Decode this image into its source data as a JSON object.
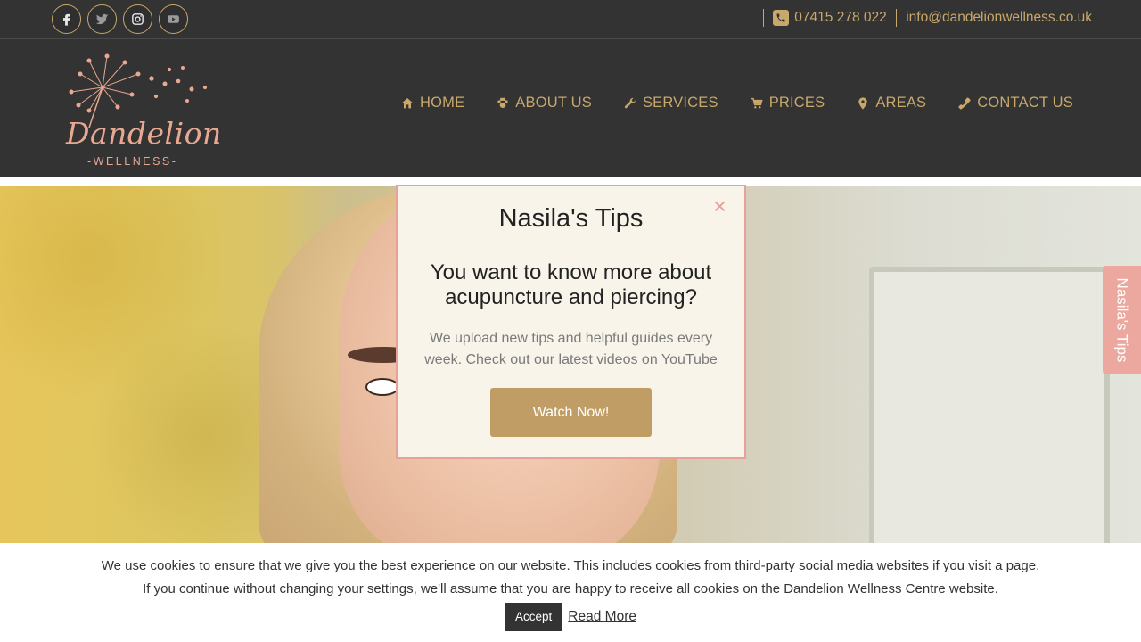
{
  "colors": {
    "header_bg": "#333333",
    "accent_gold": "#c8a86b",
    "logo_pink": "#e8a891",
    "modal_bg": "#f9f4ea",
    "modal_border": "#e8a19a",
    "button_gold": "#c09d65",
    "sidetab_bg": "#eca79e"
  },
  "topbar": {
    "social_icons": [
      "facebook-icon",
      "twitter-icon",
      "instagram-icon",
      "youtube-icon"
    ],
    "phone": "07415 278 022",
    "email": "info@dandelionwellness.co.uk"
  },
  "logo": {
    "brand": "Dandelion",
    "subtitle": "-WELLNESS-"
  },
  "nav": {
    "items": [
      {
        "label": "HOME",
        "icon": "home-icon"
      },
      {
        "label": "ABOUT US",
        "icon": "paw-icon"
      },
      {
        "label": "SERVICES",
        "icon": "wrench-icon"
      },
      {
        "label": "PRICES",
        "icon": "cart-icon"
      },
      {
        "label": "AREAS",
        "icon": "map-pin-icon"
      },
      {
        "label": "CONTACT US",
        "icon": "phone-icon"
      }
    ]
  },
  "modal": {
    "close_label": "×",
    "title": "Nasila's Tips",
    "headline": "You want to know more about acupuncture and piercing?",
    "description": "We upload new tips and helpful guides every week. Check out our latest videos on YouTube",
    "button_label": "Watch Now!"
  },
  "sidetab": {
    "label": "Nasila's Tips"
  },
  "cookie": {
    "line1": "We use cookies to ensure that we give you the best experience on our website. This includes cookies from third-party social media websites if you visit a page.",
    "line2": "If you continue without changing your settings, we'll assume that you are happy to receive all cookies on the Dandelion Wellness Centre website.",
    "accept_label": "Accept",
    "read_more_label": "Read More"
  }
}
